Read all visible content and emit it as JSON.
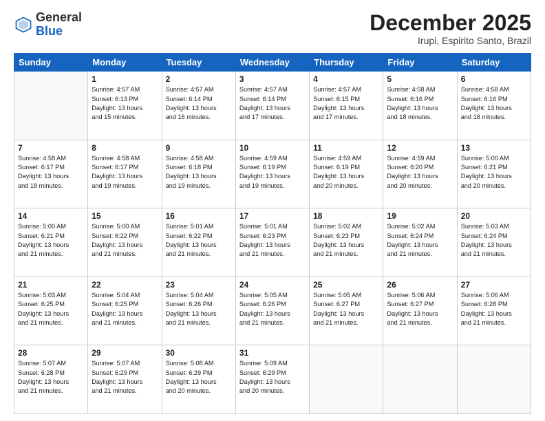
{
  "logo": {
    "general": "General",
    "blue": "Blue"
  },
  "header": {
    "month": "December 2025",
    "location": "Irupi, Espirito Santo, Brazil"
  },
  "weekdays": [
    "Sunday",
    "Monday",
    "Tuesday",
    "Wednesday",
    "Thursday",
    "Friday",
    "Saturday"
  ],
  "weeks": [
    [
      {
        "day": "",
        "info": ""
      },
      {
        "day": "1",
        "info": "Sunrise: 4:57 AM\nSunset: 6:13 PM\nDaylight: 13 hours\nand 15 minutes."
      },
      {
        "day": "2",
        "info": "Sunrise: 4:57 AM\nSunset: 6:14 PM\nDaylight: 13 hours\nand 16 minutes."
      },
      {
        "day": "3",
        "info": "Sunrise: 4:57 AM\nSunset: 6:14 PM\nDaylight: 13 hours\nand 17 minutes."
      },
      {
        "day": "4",
        "info": "Sunrise: 4:57 AM\nSunset: 6:15 PM\nDaylight: 13 hours\nand 17 minutes."
      },
      {
        "day": "5",
        "info": "Sunrise: 4:58 AM\nSunset: 6:16 PM\nDaylight: 13 hours\nand 18 minutes."
      },
      {
        "day": "6",
        "info": "Sunrise: 4:58 AM\nSunset: 6:16 PM\nDaylight: 13 hours\nand 18 minutes."
      }
    ],
    [
      {
        "day": "7",
        "info": "Sunrise: 4:58 AM\nSunset: 6:17 PM\nDaylight: 13 hours\nand 18 minutes."
      },
      {
        "day": "8",
        "info": "Sunrise: 4:58 AM\nSunset: 6:17 PM\nDaylight: 13 hours\nand 19 minutes."
      },
      {
        "day": "9",
        "info": "Sunrise: 4:58 AM\nSunset: 6:18 PM\nDaylight: 13 hours\nand 19 minutes."
      },
      {
        "day": "10",
        "info": "Sunrise: 4:59 AM\nSunset: 6:19 PM\nDaylight: 13 hours\nand 19 minutes."
      },
      {
        "day": "11",
        "info": "Sunrise: 4:59 AM\nSunset: 6:19 PM\nDaylight: 13 hours\nand 20 minutes."
      },
      {
        "day": "12",
        "info": "Sunrise: 4:59 AM\nSunset: 6:20 PM\nDaylight: 13 hours\nand 20 minutes."
      },
      {
        "day": "13",
        "info": "Sunrise: 5:00 AM\nSunset: 6:21 PM\nDaylight: 13 hours\nand 20 minutes."
      }
    ],
    [
      {
        "day": "14",
        "info": "Sunrise: 5:00 AM\nSunset: 6:21 PM\nDaylight: 13 hours\nand 21 minutes."
      },
      {
        "day": "15",
        "info": "Sunrise: 5:00 AM\nSunset: 6:22 PM\nDaylight: 13 hours\nand 21 minutes."
      },
      {
        "day": "16",
        "info": "Sunrise: 5:01 AM\nSunset: 6:22 PM\nDaylight: 13 hours\nand 21 minutes."
      },
      {
        "day": "17",
        "info": "Sunrise: 5:01 AM\nSunset: 6:23 PM\nDaylight: 13 hours\nand 21 minutes."
      },
      {
        "day": "18",
        "info": "Sunrise: 5:02 AM\nSunset: 6:23 PM\nDaylight: 13 hours\nand 21 minutes."
      },
      {
        "day": "19",
        "info": "Sunrise: 5:02 AM\nSunset: 6:24 PM\nDaylight: 13 hours\nand 21 minutes."
      },
      {
        "day": "20",
        "info": "Sunrise: 5:03 AM\nSunset: 6:24 PM\nDaylight: 13 hours\nand 21 minutes."
      }
    ],
    [
      {
        "day": "21",
        "info": "Sunrise: 5:03 AM\nSunset: 6:25 PM\nDaylight: 13 hours\nand 21 minutes."
      },
      {
        "day": "22",
        "info": "Sunrise: 5:04 AM\nSunset: 6:25 PM\nDaylight: 13 hours\nand 21 minutes."
      },
      {
        "day": "23",
        "info": "Sunrise: 5:04 AM\nSunset: 6:26 PM\nDaylight: 13 hours\nand 21 minutes."
      },
      {
        "day": "24",
        "info": "Sunrise: 5:05 AM\nSunset: 6:26 PM\nDaylight: 13 hours\nand 21 minutes."
      },
      {
        "day": "25",
        "info": "Sunrise: 5:05 AM\nSunset: 6:27 PM\nDaylight: 13 hours\nand 21 minutes."
      },
      {
        "day": "26",
        "info": "Sunrise: 5:06 AM\nSunset: 6:27 PM\nDaylight: 13 hours\nand 21 minutes."
      },
      {
        "day": "27",
        "info": "Sunrise: 5:06 AM\nSunset: 6:28 PM\nDaylight: 13 hours\nand 21 minutes."
      }
    ],
    [
      {
        "day": "28",
        "info": "Sunrise: 5:07 AM\nSunset: 6:28 PM\nDaylight: 13 hours\nand 21 minutes."
      },
      {
        "day": "29",
        "info": "Sunrise: 5:07 AM\nSunset: 6:29 PM\nDaylight: 13 hours\nand 21 minutes."
      },
      {
        "day": "30",
        "info": "Sunrise: 5:08 AM\nSunset: 6:29 PM\nDaylight: 13 hours\nand 20 minutes."
      },
      {
        "day": "31",
        "info": "Sunrise: 5:09 AM\nSunset: 6:29 PM\nDaylight: 13 hours\nand 20 minutes."
      },
      {
        "day": "",
        "info": ""
      },
      {
        "day": "",
        "info": ""
      },
      {
        "day": "",
        "info": ""
      }
    ]
  ]
}
